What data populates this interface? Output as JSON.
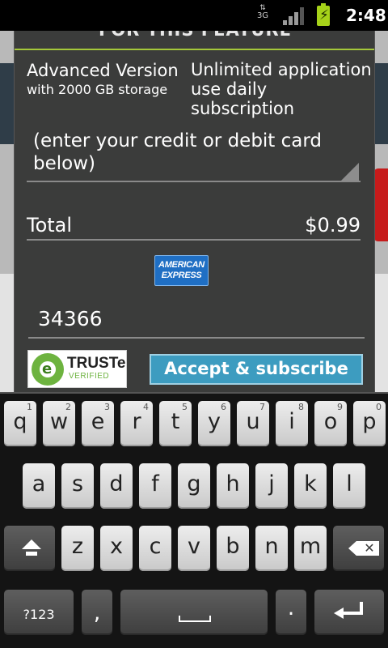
{
  "status_bar": {
    "network": "3G",
    "time": "2:48",
    "icons": [
      "3g-data-icon",
      "signal-icon",
      "battery-charging-icon"
    ]
  },
  "dialog": {
    "title": "FOR THIS FEATURE",
    "plan": {
      "name": "Advanced Version",
      "detail": "with 2000 GB storage",
      "description_line1": "Unlimited application",
      "description_line2": "use daily subscription"
    },
    "card_select": {
      "line1": "(enter your credit or debit card",
      "line2": "below)"
    },
    "total": {
      "label": "Total",
      "amount": "$0.99"
    },
    "card_logo": {
      "line1": "AMERICAN",
      "line2": "EXPRESS"
    },
    "zip_input": {
      "value": "34366"
    },
    "trust_badge": {
      "name": "TRUSTe",
      "status": "VERIFIED"
    },
    "accept_button": "Accept & subscribe"
  },
  "keyboard": {
    "row1": [
      {
        "ch": "q",
        "hint": "1"
      },
      {
        "ch": "w",
        "hint": "2"
      },
      {
        "ch": "e",
        "hint": "3"
      },
      {
        "ch": "r",
        "hint": "4"
      },
      {
        "ch": "t",
        "hint": "5"
      },
      {
        "ch": "y",
        "hint": "6"
      },
      {
        "ch": "u",
        "hint": "7"
      },
      {
        "ch": "i",
        "hint": "8"
      },
      {
        "ch": "o",
        "hint": "9"
      },
      {
        "ch": "p",
        "hint": "0"
      }
    ],
    "row2": [
      "a",
      "s",
      "d",
      "f",
      "g",
      "h",
      "j",
      "k",
      "l"
    ],
    "row3": [
      "z",
      "x",
      "c",
      "v",
      "b",
      "n",
      "m"
    ],
    "symbols_key": "?123",
    "comma_key": ",",
    "period_key": "."
  }
}
